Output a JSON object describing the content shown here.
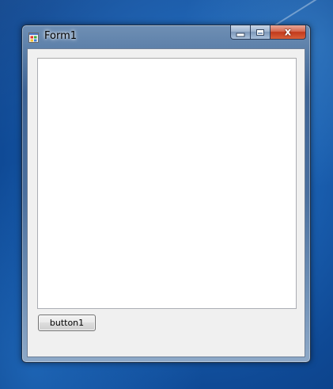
{
  "window": {
    "title": "Form1",
    "icon": "winforms-app-icon"
  },
  "caption_buttons": {
    "minimize": "minimize-icon",
    "maximize": "maximize-icon",
    "close": "close-icon",
    "close_glyph": "x"
  },
  "form": {
    "textbox_value": "",
    "button1_label": "button1"
  },
  "colors": {
    "desktop": "#1a5fb0",
    "client_background": "#f0f0f0",
    "close_button": "#c2391b"
  }
}
